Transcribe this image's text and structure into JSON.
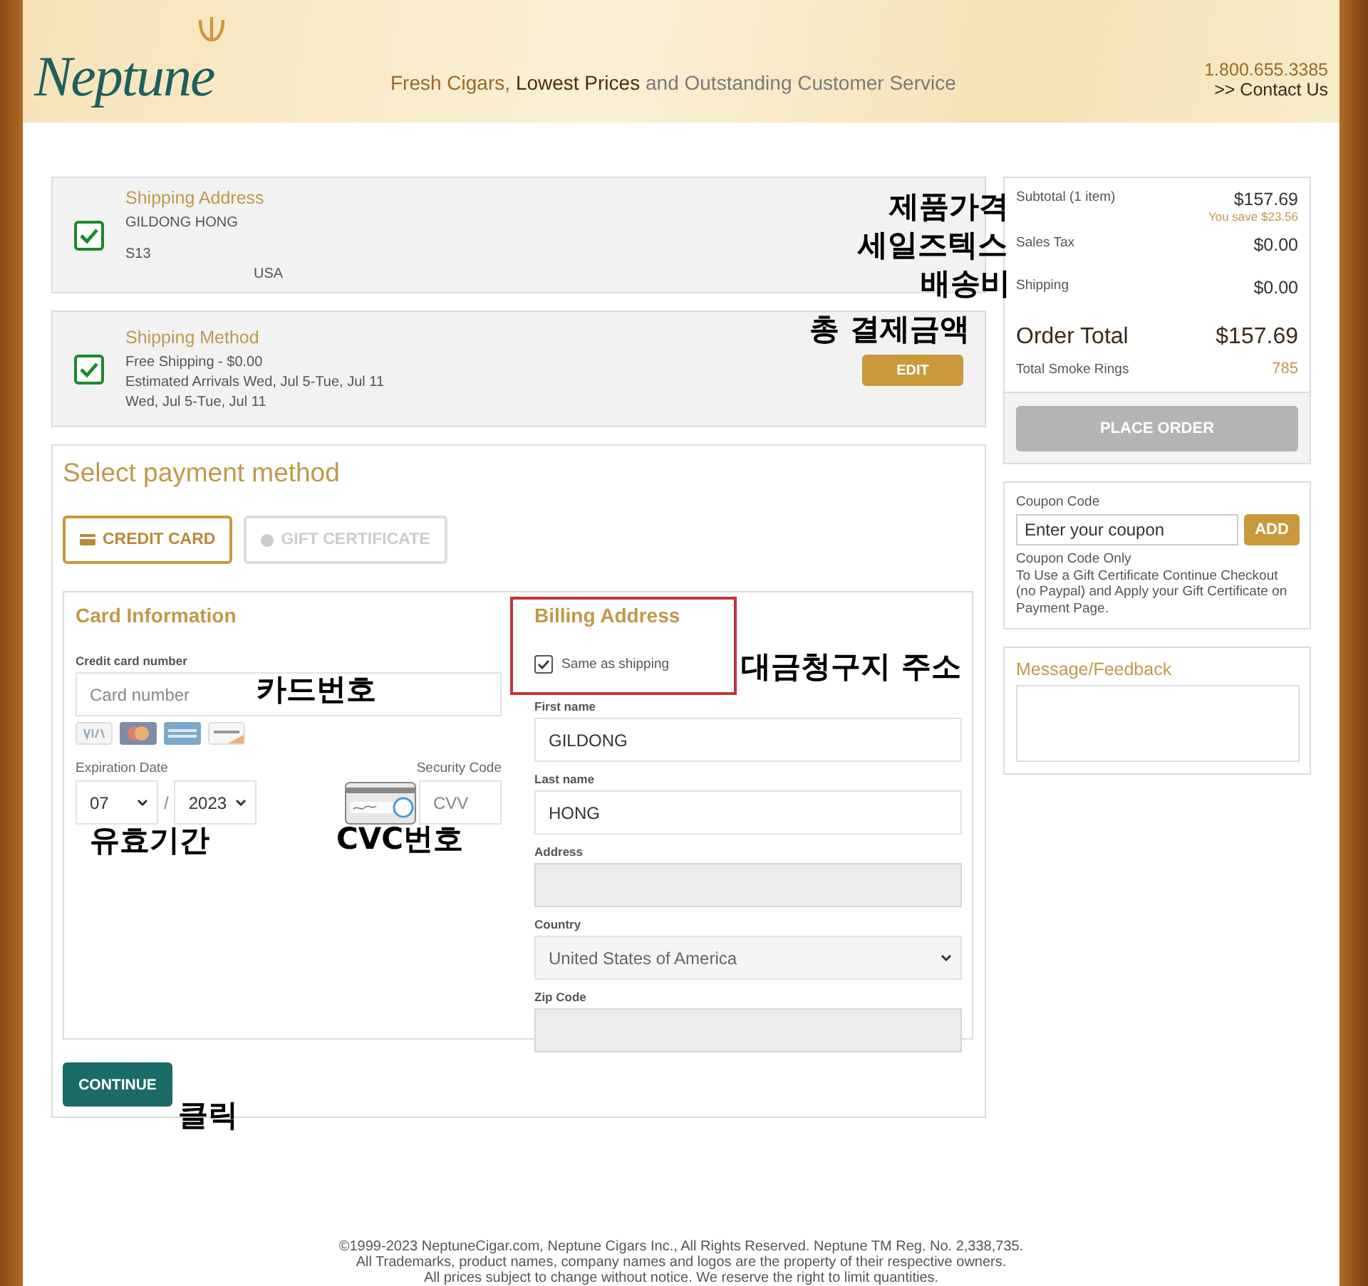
{
  "header": {
    "logo": "Neptune",
    "tagline": [
      {
        "text": "Fresh Cigars,",
        "kind": "accent"
      },
      {
        "text": "Lowest Prices",
        "kind": "strong"
      },
      {
        "text": "and Outstanding Customer Service",
        "kind": "plain"
      }
    ],
    "phone": "1.800.655.3385",
    "contact_link": ">> Contact Us"
  },
  "shipping_address": {
    "title": "Shipping Address",
    "checked": true,
    "lines": [
      "GILDONG HONG",
      "S13",
      "USA"
    ]
  },
  "shipping_method": {
    "title": "Shipping Method",
    "checked": true,
    "lines": [
      "Free Shipping - $0.00",
      "Estimated Arrivals Wed, Jul 5-Tue, Jul 11",
      "Wed, Jul 5-Tue, Jul 11"
    ],
    "edit_button": "EDIT"
  },
  "payment": {
    "title": "Select payment method",
    "methods": [
      {
        "label": "CREDIT CARD",
        "kind": "card",
        "selected": true
      },
      {
        "label": "GIFT CERTIFICATE",
        "kind": "gift",
        "selected": false
      }
    ],
    "card_info": {
      "title": "Card Information",
      "number_label": "Credit card number",
      "number_placeholder": "Card number",
      "expiration_label": "Expiration Date",
      "month": "07",
      "separator": "/",
      "year": "2023",
      "security_label": "Security Code",
      "cvv_placeholder": "CVV"
    },
    "billing": {
      "title": "Billing Address",
      "same_as_shipping": {
        "label": "Same as shipping",
        "checked": true
      },
      "fields": [
        {
          "label": "First name",
          "value": "GILDONG",
          "kind": "input",
          "disabled": false
        },
        {
          "label": "Last name",
          "value": "HONG",
          "kind": "input",
          "disabled": false
        },
        {
          "label": "Address",
          "kind": "input",
          "disabled": true
        },
        {
          "label": "Country",
          "value": "United States of America",
          "kind": "select",
          "disabled": true
        },
        {
          "label": "Zip Code",
          "kind": "input",
          "disabled": true
        }
      ]
    },
    "continue_button": "CONTINUE"
  },
  "summary": {
    "rows": [
      {
        "label": "Subtotal (1 item)",
        "value": "$157.69",
        "note": "You save $23.56",
        "kind": "normal"
      },
      {
        "label": "Sales Tax",
        "value": "$0.00",
        "kind": "normal"
      },
      {
        "label": "Shipping",
        "value": "$0.00",
        "kind": "normal"
      },
      {
        "label": "Order Total",
        "value": "$157.69",
        "kind": "total"
      },
      {
        "label": "Total Smoke Rings",
        "value": "785",
        "kind": "points"
      }
    ],
    "place_order": {
      "label": "PLACE ORDER",
      "disabled": true
    }
  },
  "coupon": {
    "label": "Coupon Code",
    "placeholder": "Enter your coupon",
    "button": "ADD",
    "notes": [
      "Coupon Code Only",
      "To Use a Gift Certificate Continue Checkout (no Paypal) and Apply your Gift Certificate on Payment Page."
    ]
  },
  "feedback": {
    "title": "Message/Feedback"
  },
  "footer": {
    "lines": [
      "©1999-2023 NeptuneCigar.com, Neptune Cigars Inc., All Rights Reserved. Neptune TM Reg. No. 2,338,735.",
      "All Trademarks, product names, company names and logos are the property of their respective owners.",
      "All prices subject to change without notice. We reserve the right to limit quantities."
    ]
  },
  "annotations": [
    {
      "text": "제품가격"
    },
    {
      "text": "세일즈텍스"
    },
    {
      "text": "배송비"
    },
    {
      "text": "총 결제금액"
    },
    {
      "text": "카드번호"
    },
    {
      "text": "대금청구지 주소"
    },
    {
      "text": "유효기간"
    },
    {
      "text": "CVC번호"
    },
    {
      "text": "클릭"
    }
  ]
}
